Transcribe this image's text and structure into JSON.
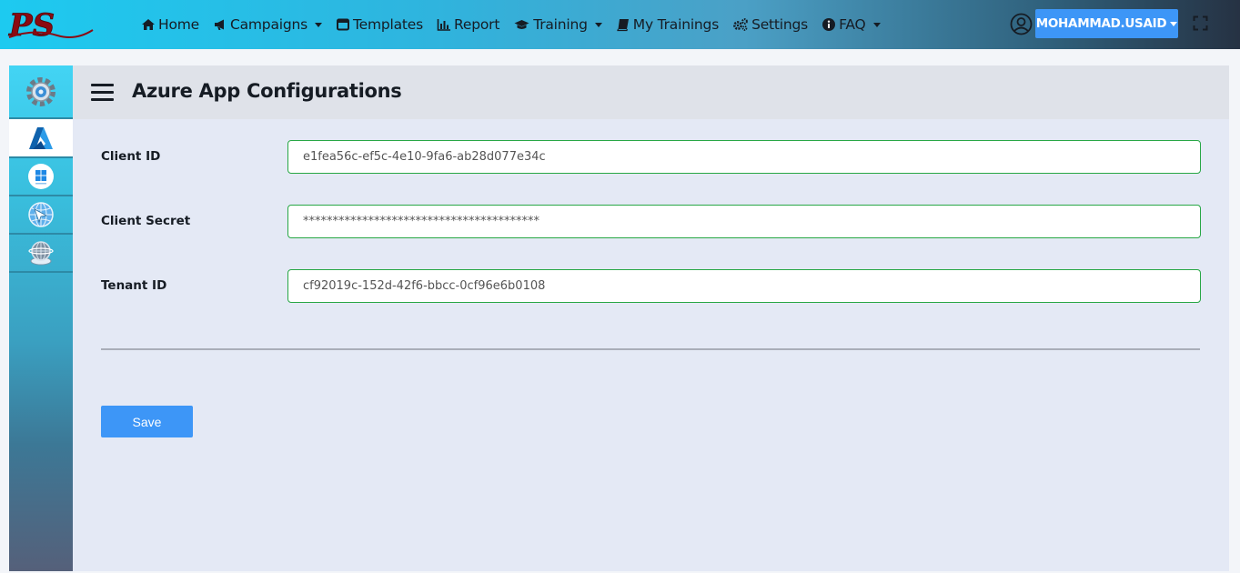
{
  "brand": {
    "logo_text": "PS",
    "logo_color": "#8b0a12"
  },
  "nav": {
    "items": [
      {
        "label": "Home",
        "icon": "home-icon"
      },
      {
        "label": "Campaigns",
        "icon": "bullhorn-icon",
        "dropdown": true
      },
      {
        "label": "Templates",
        "icon": "window-icon"
      },
      {
        "label": "Report",
        "icon": "bar-chart-icon"
      },
      {
        "label": "Training",
        "icon": "graduation-cap-icon",
        "dropdown": true
      },
      {
        "label": "My Trainings",
        "icon": "book-icon"
      },
      {
        "label": "Settings",
        "icon": "gears-icon"
      },
      {
        "label": "FAQ",
        "icon": "info-circle-icon",
        "dropdown": true
      }
    ]
  },
  "user": {
    "name": "MOHAMMAD.USAID",
    "icon": "user-circle-icon"
  },
  "sidebar": {
    "items": [
      {
        "icon": "gear-icon",
        "active": false
      },
      {
        "icon": "azure-icon",
        "active": true
      },
      {
        "icon": "windows-icon",
        "active": false
      },
      {
        "icon": "globe-network-icon",
        "active": false
      },
      {
        "icon": "cloud-globe-icon",
        "active": false
      }
    ]
  },
  "page": {
    "title": "Azure App Configurations",
    "fields": [
      {
        "label": "Client ID",
        "value": "e1fea56c-ef5c-4e10-9fa6-ab28d077e34c"
      },
      {
        "label": "Client Secret",
        "value": "****************************************"
      },
      {
        "label": "Tenant ID",
        "value": "cf92019c-152d-42f6-bbcc-0cf96e6b0108"
      }
    ],
    "save_label": "Save"
  },
  "colors": {
    "accent": "#3d96f7",
    "input_border": "#28a745",
    "card_bg": "#e4e9f5"
  }
}
